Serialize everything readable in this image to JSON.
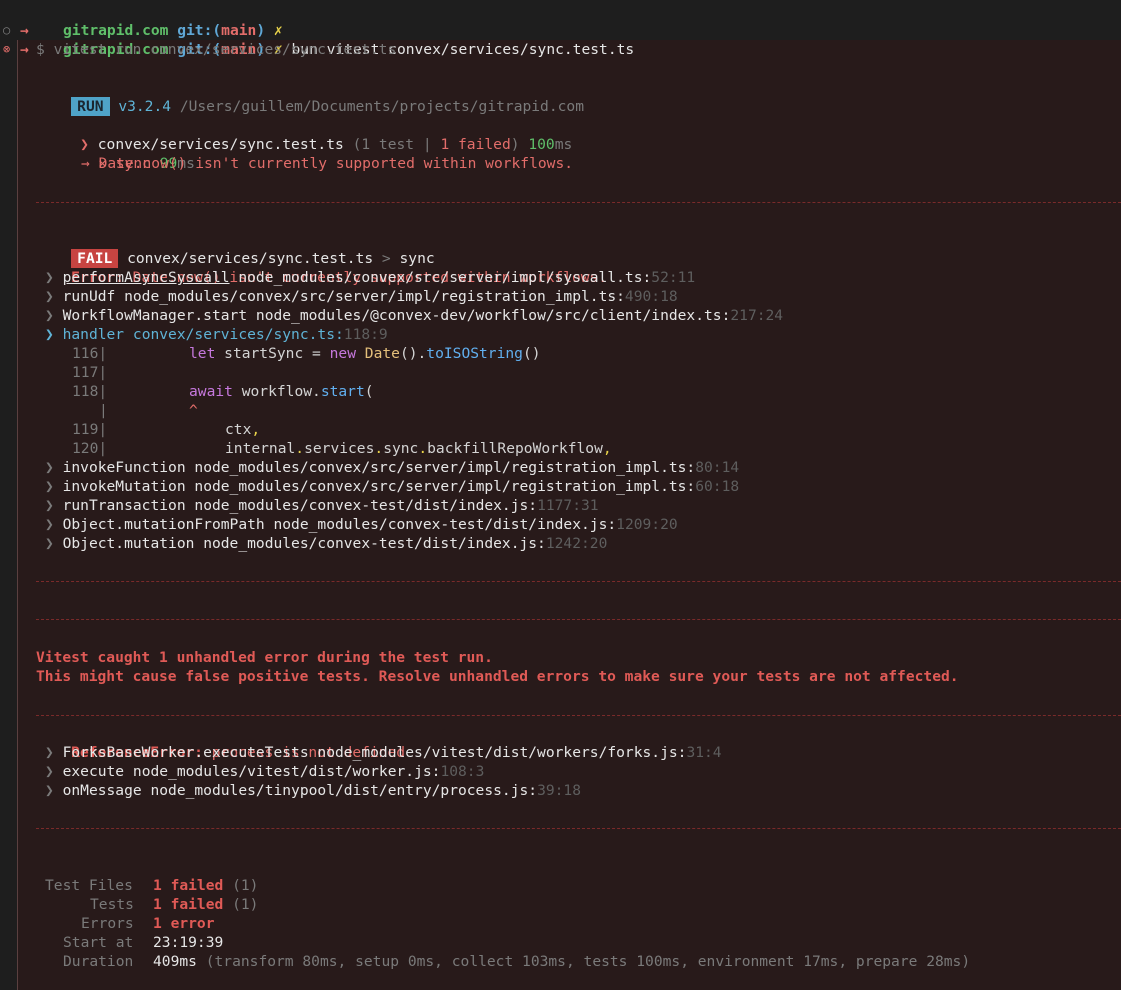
{
  "prompt": {
    "arrow": "→",
    "dir": "gitrapid.com",
    "git_label": "git:(",
    "branch": "main",
    "git_close": ")",
    "dirty": "✗",
    "command": "bun vitest convex/services/sync.test.ts"
  },
  "exec_line": "$ vitest run convex/services/sync.test.ts",
  "run_header": {
    "badge": "RUN",
    "version": "v3.2.4",
    "path": "/Users/guillem/Documents/projects/gitrapid.com"
  },
  "file_summary": {
    "chevron": "❯",
    "file": "convex/services/sync.test.ts",
    "open": "(1 test |",
    "failed": "1 failed",
    "close": ")",
    "time": "100",
    "unit": "ms"
  },
  "test_result": {
    "mark": "×",
    "name": "sync",
    "time": "99",
    "unit": "ms"
  },
  "test_error": "→ Date.now() isn't currently supported within workflows.",
  "fail_block": {
    "badge": "FAIL",
    "file": "convex/services/sync.test.ts",
    "sep": ">",
    "test": "sync",
    "error_label": "Error:",
    "error_msg": "Date.now() isn't currently supported within workflows."
  },
  "stack": [
    {
      "fn": "performAsyncSyscall",
      "path": "node_modules/convex/src/server/impl/syscall.ts:",
      "loc": "52:11"
    },
    {
      "fn": "runUdf",
      "path": "node_modules/convex/src/server/impl/registration_impl.ts:",
      "loc": "490:18"
    },
    {
      "fn": "WorkflowManager.start",
      "path": "node_modules/@convex-dev/workflow/src/client/index.ts:",
      "loc": "217:24"
    },
    {
      "fn": "handler",
      "path": "convex/services/sync.ts:",
      "loc": "118:9"
    }
  ],
  "code": {
    "l116": "116|",
    "l117": "117|",
    "l118": "118|",
    "l119": "119|",
    "l120": "120|",
    "blank_bar": "|",
    "let": "let",
    "startSync": "startSync",
    "eq": "=",
    "new": "new",
    "Date": "Date",
    "paren1": "().",
    "toISO": "toISOString",
    "paren2": "()",
    "await": "await",
    "workflow": "workflow",
    "dot": ".",
    "start": "start",
    "open": "(",
    "caret": "^",
    "ctx": "ctx",
    "comma": ",",
    "internal": "internal",
    "services": "services",
    "sync": "sync",
    "backfill": "backfillRepoWorkflow"
  },
  "stack2": [
    {
      "fn": "invokeFunction",
      "path": "node_modules/convex/src/server/impl/registration_impl.ts:",
      "loc": "80:14"
    },
    {
      "fn": "invokeMutation",
      "path": "node_modules/convex/src/server/impl/registration_impl.ts:",
      "loc": "60:18"
    },
    {
      "fn": "runTransaction",
      "path": "node_modules/convex-test/dist/index.js:",
      "loc": "1177:31"
    },
    {
      "fn": "Object.mutationFromPath",
      "path": "node_modules/convex-test/dist/index.js:",
      "loc": "1209:20"
    },
    {
      "fn": "Object.mutation",
      "path": "node_modules/convex-test/dist/index.js:",
      "loc": "1242:20"
    }
  ],
  "unhandled": {
    "line1": "Vitest caught 1 unhandled error during the test run.",
    "line2": "This might cause false positive tests. Resolve unhandled errors to make sure your tests are not affected."
  },
  "ref_error": {
    "label": "ReferenceError:",
    "msg": "process is not defined"
  },
  "stack3": [
    {
      "fn": "ForksBaseWorker.executeTests",
      "path": "node_modules/vitest/dist/workers/forks.js:",
      "loc": "31:4"
    },
    {
      "fn": "execute",
      "path": "node_modules/vitest/dist/worker.js:",
      "loc": "108:3"
    },
    {
      "fn": "onMessage",
      "path": "node_modules/tinypool/dist/entry/process.js:",
      "loc": "39:18"
    }
  ],
  "summary": {
    "test_files": {
      "label": "Test Files",
      "value": "1 failed",
      "extra": "(1)"
    },
    "tests": {
      "label": "Tests",
      "value": "1 failed",
      "extra": "(1)"
    },
    "errors": {
      "label": "Errors",
      "value": "1 error"
    },
    "start_at": {
      "label": "Start at",
      "value": "23:19:39"
    },
    "duration": {
      "label": "Duration",
      "value": "409ms",
      "extra": "(transform 80ms, setup 0ms, collect 103ms, tests 100ms, environment 17ms, prepare 28ms)"
    }
  },
  "stack_chevron": "❯"
}
